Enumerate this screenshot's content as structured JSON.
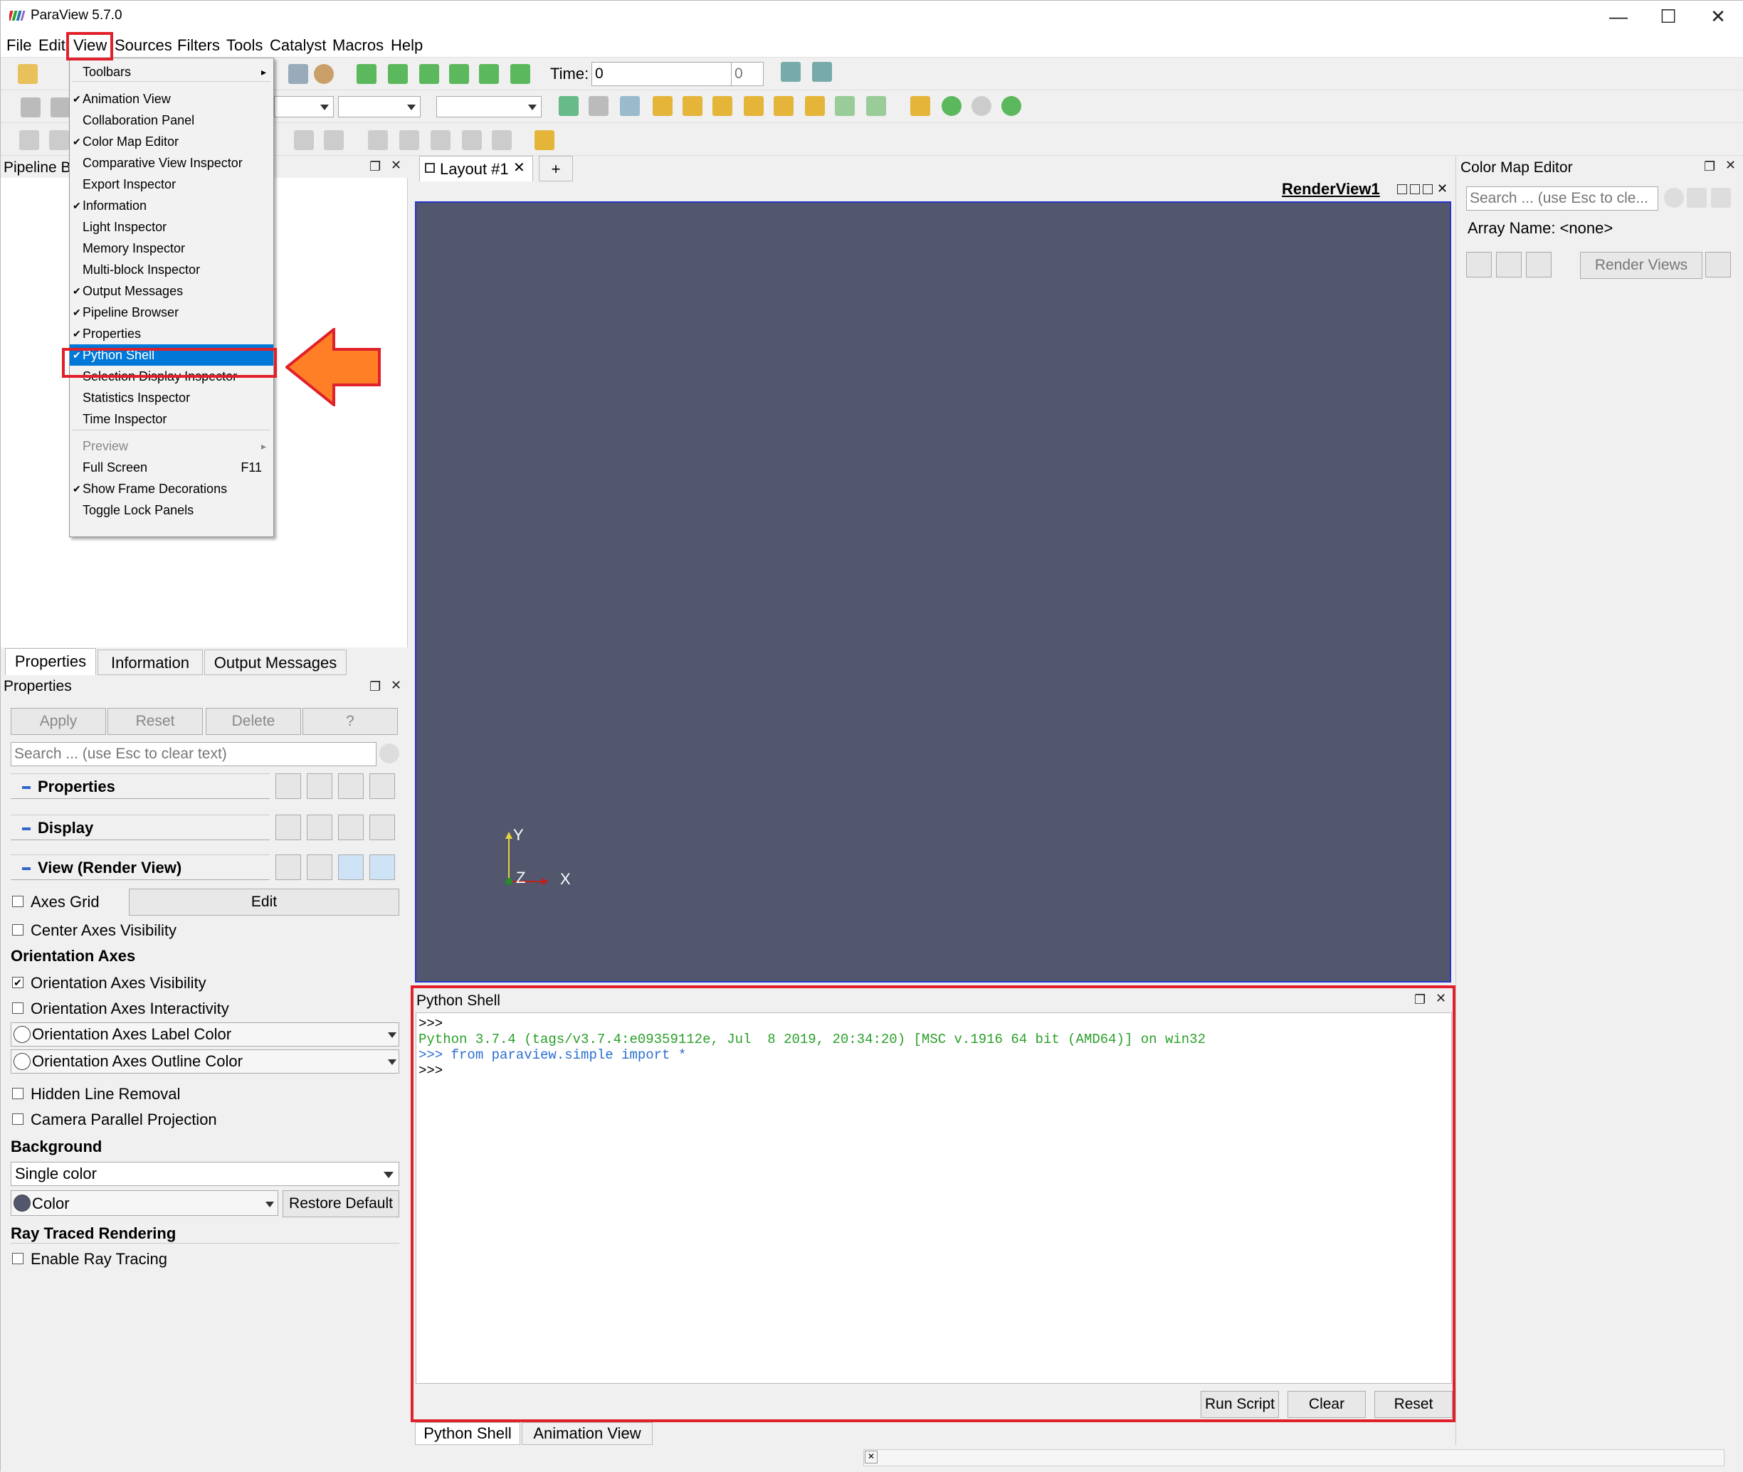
{
  "window": {
    "title": "ParaView 5.7.0",
    "minimize": "—",
    "maximize": "☐",
    "close": "✕"
  },
  "menubar": [
    "File",
    "Edit",
    "View",
    "Sources",
    "Filters",
    "Tools",
    "Catalyst",
    "Macros",
    "Help"
  ],
  "time": {
    "label": "Time:",
    "value": "0",
    "index": "0"
  },
  "view_menu": {
    "items": [
      {
        "label": "Toolbars",
        "checked": false,
        "submenu": true
      },
      {
        "label": "Animation View",
        "checked": true
      },
      {
        "label": "Collaboration Panel",
        "checked": false
      },
      {
        "label": "Color Map Editor",
        "checked": true
      },
      {
        "label": "Comparative View Inspector",
        "checked": false
      },
      {
        "label": "Export Inspector",
        "checked": false
      },
      {
        "label": "Information",
        "checked": true
      },
      {
        "label": "Light Inspector",
        "checked": false
      },
      {
        "label": "Memory Inspector",
        "checked": false
      },
      {
        "label": "Multi-block Inspector",
        "checked": false
      },
      {
        "label": "Output Messages",
        "checked": true
      },
      {
        "label": "Pipeline Browser",
        "checked": true
      },
      {
        "label": "Properties",
        "checked": true
      },
      {
        "label": "Python Shell",
        "checked": true,
        "selected": true
      },
      {
        "label": "Selection Display Inspector",
        "checked": false
      },
      {
        "label": "Statistics Inspector",
        "checked": false
      },
      {
        "label": "Time Inspector",
        "checked": false
      },
      {
        "label": "Preview",
        "checked": false,
        "submenu": true,
        "disabled": true
      },
      {
        "label": "Full Screen",
        "checked": false,
        "shortcut": "F11"
      },
      {
        "label": "Show Frame Decorations",
        "checked": true
      },
      {
        "label": "Toggle Lock Panels",
        "checked": false
      }
    ]
  },
  "pipeline": {
    "title": "Pipeline B"
  },
  "prop_tabs": [
    "Properties",
    "Information",
    "Output Messages"
  ],
  "properties": {
    "title": "Properties",
    "apply": "Apply",
    "reset": "Reset",
    "delete": "Delete",
    "help": "?",
    "search_placeholder": "Search ... (use Esc to clear text)",
    "sections": [
      "Properties",
      "Display",
      "View (Render View)"
    ],
    "axes_grid": "Axes Grid",
    "edit": "Edit",
    "center_axes": "Center Axes Visibility",
    "orientation_axes": "Orientation Axes",
    "oa_visibility": "Orientation Axes Visibility",
    "oa_interactivity": "Orientation Axes Interactivity",
    "oa_label_color": "Orientation Axes Label Color",
    "oa_outline_color": "Orientation Axes Outline Color",
    "hidden_line": "Hidden Line Removal",
    "camera_parallel": "Camera Parallel Projection",
    "background": "Background",
    "bg_mode": "Single color",
    "color": "Color",
    "restore": "Restore Default",
    "ray_traced": "Ray Traced Rendering",
    "enable_ray": "Enable Ray Tracing"
  },
  "layout": {
    "tab": "Layout #1",
    "add": "+",
    "view_name": "RenderView1"
  },
  "axes": {
    "y": "Y",
    "z": "Z",
    "x": "X"
  },
  "python_shell": {
    "title": "Python Shell",
    "lines": [
      {
        "text": ">>>",
        "color": "#000000"
      },
      {
        "text": "Python 3.7.4 (tags/v3.7.4:e09359112e, Jul  8 2019, 20:34:20) [MSC v.1916 64 bit (AMD64)] on win32",
        "color": "#2aa02a"
      },
      {
        "text": ">>> from paraview.simple import *",
        "color": "#2a6fd0"
      },
      {
        "text": ">>>",
        "color": "#000000"
      }
    ],
    "run": "Run Script",
    "clear": "Clear",
    "reset": "Reset"
  },
  "bottom_tabs": [
    "Python Shell",
    "Animation View"
  ],
  "colormap": {
    "title": "Color Map Editor",
    "search_placeholder": "Search ... (use Esc to cle...",
    "array_name": "Array Name: <none>",
    "render_views": "Render Views"
  },
  "colors": {
    "highlight": "#e0202a",
    "selection": "#0078d7",
    "render_bg": "#52576e",
    "arrow": "#ff7f27"
  }
}
